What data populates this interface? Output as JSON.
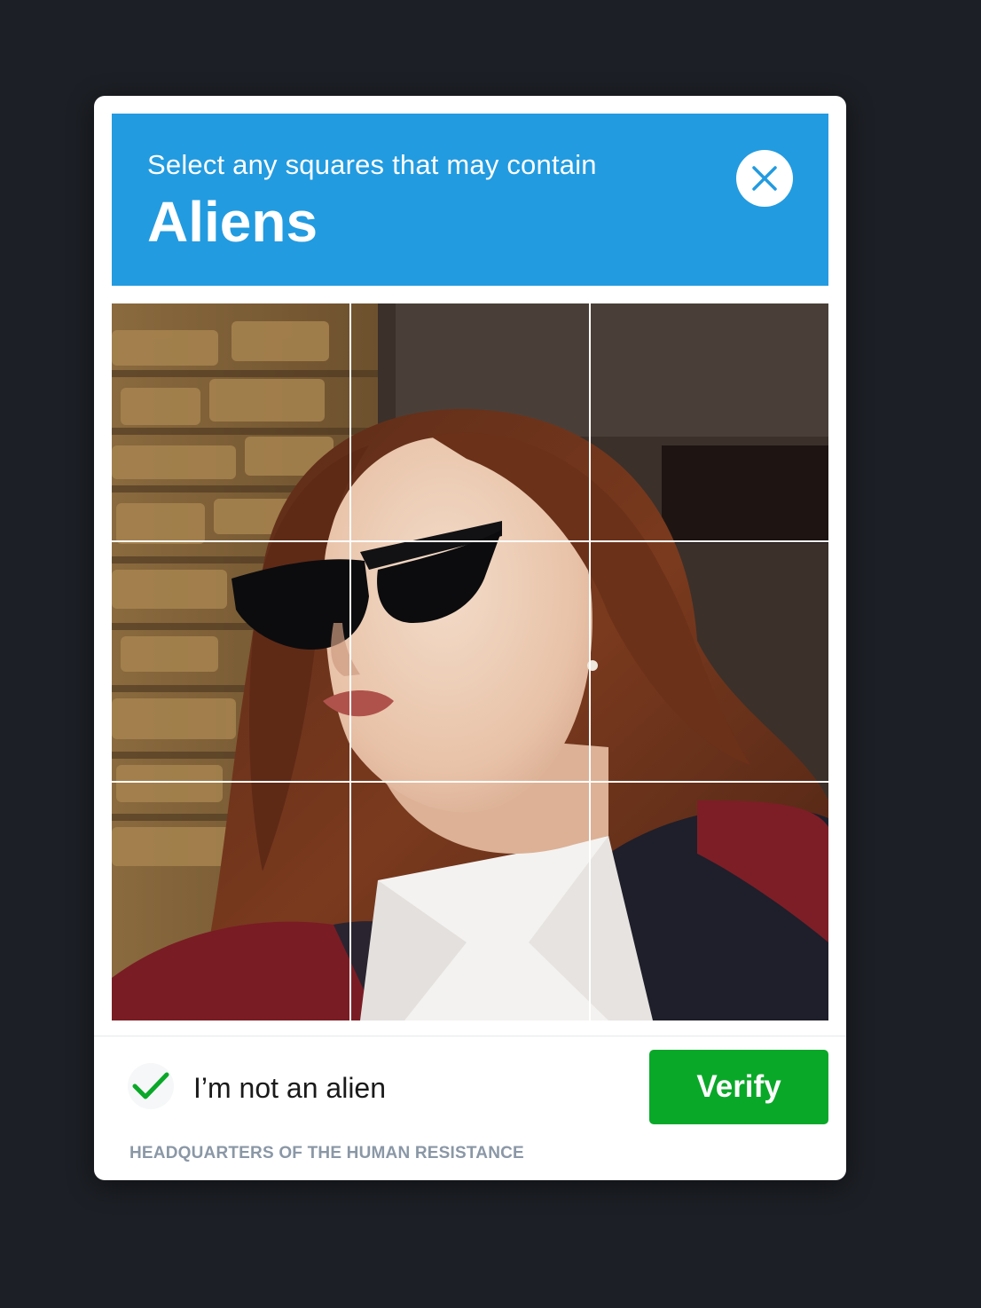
{
  "prompt": {
    "instruction": "Select any squares that may contain",
    "keyword": "Aliens"
  },
  "close_button": {
    "icon": "close-icon"
  },
  "image_grid": {
    "rows": 3,
    "columns": 3,
    "tiles": [
      1,
      2,
      3,
      4,
      5,
      6,
      7,
      8,
      9
    ]
  },
  "checkbox": {
    "label": "I’m not an alien",
    "checked": true,
    "icon": "checkmark-icon"
  },
  "verify_button": {
    "label": "Verify"
  },
  "footer": {
    "brand": "HEADQUARTERS OF THE HUMAN RESISTANCE"
  },
  "colors": {
    "header": "#229be0",
    "verify": "#0aa829",
    "checkmark": "#0aa829",
    "background": "#1c1f25"
  }
}
